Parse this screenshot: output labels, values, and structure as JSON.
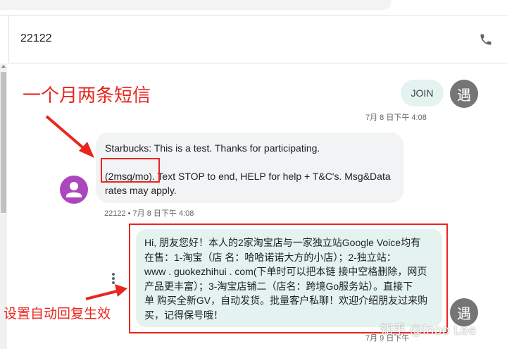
{
  "conversation": {
    "contact_number": "22122"
  },
  "outgoing_join": {
    "text": "JOIN",
    "avatar_letter": "遇",
    "timestamp": "7月 8 日下午 4:08"
  },
  "incoming": {
    "line1": "Starbucks: This is a test. Thanks for participating.",
    "line2_highlight": "(2msg/mo)",
    "line2_rest": ". Text STOP to end, HELP for help + T&C's. Msg&Data",
    "line3": "rates may apply.",
    "meta": "22122 • 7月 8 日下午 4:08"
  },
  "auto_reply": {
    "lines": [
      "Hi, 朋友您好！本人的2家淘宝店与一家独立站Google Voice均有",
      "在售：1-淘宝（店 名：哈哈诺诺大方的小店）；2-独立站：",
      "www . guokezhihui . com(下单时可以把本链 接中空格删除，网页",
      "产品更丰富）；3-淘宝店铺二（店名：跨境Go服务站）。直接下",
      "单 购买全新GV，自动发货。批量客户私聊！欢迎介绍朋友过来购",
      "买，记得保号哦！"
    ],
    "avatar_letter": "遇",
    "timestamp": "7月 9 日下午"
  },
  "annotations": {
    "monthly": "一个月两条短信",
    "auto_reply": "设置自动回复生效",
    "color": "#e8261f"
  },
  "icons": {
    "phone": "phone-icon",
    "more": "more-vert-icon",
    "contact_avatar": "person-avatar-icon"
  },
  "watermark": "知乎 @Inoo Lee"
}
